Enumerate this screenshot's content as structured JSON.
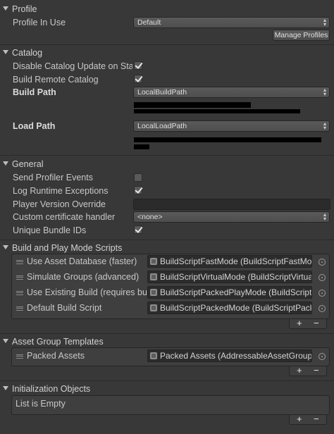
{
  "profile": {
    "header": "Profile",
    "in_use_label": "Profile In Use",
    "in_use_value": "Default",
    "manage_button": "Manage Profiles"
  },
  "catalog": {
    "header": "Catalog",
    "disable_update_label": "Disable Catalog Update on Startup",
    "disable_update_checked": true,
    "build_remote_label": "Build Remote Catalog",
    "build_remote_checked": true,
    "build_path_label": "Build Path",
    "build_path_value": "LocalBuildPath",
    "load_path_label": "Load Path",
    "load_path_value": "LocalLoadPath"
  },
  "general": {
    "header": "General",
    "send_profiler_label": "Send Profiler Events",
    "send_profiler_checked": false,
    "log_runtime_label": "Log Runtime Exceptions",
    "log_runtime_checked": true,
    "player_version_label": "Player Version Override",
    "player_version_value": "",
    "cert_handler_label": "Custom certificate handler",
    "cert_handler_value": "<none>",
    "unique_ids_label": "Unique Bundle IDs",
    "unique_ids_checked": true
  },
  "build_scripts": {
    "header": "Build and Play Mode Scripts",
    "items": [
      {
        "label": "Use Asset Database (faster)",
        "value": "BuildScriptFastMode (BuildScriptFastMode)"
      },
      {
        "label": "Simulate Groups (advanced)",
        "value": "BuildScriptVirtualMode (BuildScriptVirtualMode)"
      },
      {
        "label": "Use Existing Build (requires built groups)",
        "value": "BuildScriptPackedPlayMode (BuildScriptPackedPlayMode)"
      },
      {
        "label": "Default Build Script",
        "value": "BuildScriptPackedMode (BuildScriptPackedMode)"
      }
    ],
    "add_label": "+",
    "remove_label": "−"
  },
  "templates": {
    "header": "Asset Group Templates",
    "items": [
      {
        "label": "Packed Assets",
        "value": "Packed Assets (AddressableAssetGroupTemplate)"
      }
    ],
    "add_label": "+",
    "remove_label": "−"
  },
  "init_objects": {
    "header": "Initialization Objects",
    "empty_text": "List is Empty",
    "add_label": "+",
    "remove_label": "−"
  }
}
